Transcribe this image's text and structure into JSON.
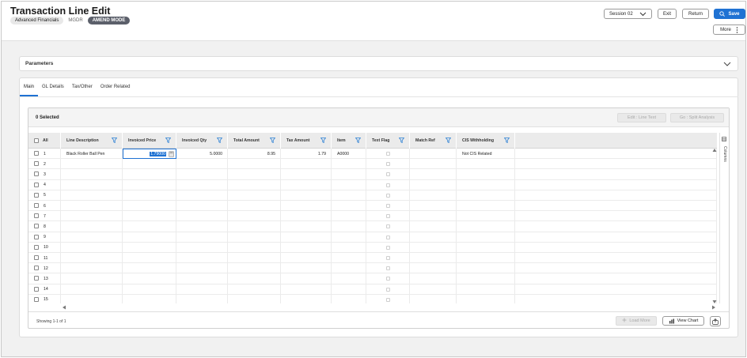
{
  "header": {
    "title": "Transaction Line Edit",
    "company": "Advanced Financials",
    "code": "MGDR",
    "mode": "AMEND MODE",
    "session_label": "Session 02",
    "exit_label": "Exit",
    "return_label": "Return",
    "save_label": "Save",
    "more_label": "More"
  },
  "parameters": {
    "title": "Parameters"
  },
  "tabs": [
    {
      "label": "Main",
      "active": true
    },
    {
      "label": "GL Details",
      "active": false
    },
    {
      "label": "Tax/Other",
      "active": false
    },
    {
      "label": "Order Related",
      "active": false
    }
  ],
  "grid": {
    "selected_count": "0 Selected",
    "edit_line_text": "Edit : Line Text",
    "go_split_analysis": "Go : Split Analysis",
    "all_label": "All",
    "columns_label": "Columns",
    "columns": [
      "Line Description",
      "Invoiced Price",
      "Invoiced Qty",
      "Total Amount",
      "Tax Amount",
      "Item",
      "Text Flag",
      "Match Ref",
      "CIS Withholding"
    ],
    "rows": [
      {
        "num": "1",
        "line_description": "Black Roller Ball Pen",
        "invoiced_price": "1.79000",
        "invoiced_qty": "5.0000",
        "total_amount": "8.95",
        "tax_amount": "1.79",
        "item": "A0000",
        "match_ref": "",
        "cis_withholding": "Not CIS Related"
      },
      {
        "num": "2"
      },
      {
        "num": "3"
      },
      {
        "num": "4"
      },
      {
        "num": "5"
      },
      {
        "num": "6"
      },
      {
        "num": "7"
      },
      {
        "num": "8"
      },
      {
        "num": "9"
      },
      {
        "num": "10"
      },
      {
        "num": "11"
      },
      {
        "num": "12"
      },
      {
        "num": "13"
      },
      {
        "num": "14"
      },
      {
        "num": "15"
      }
    ],
    "showing": "Showing 1-1 of 1",
    "load_more": "Load More",
    "view_chart": "View Chart"
  },
  "colors": {
    "accent": "#1f72d3",
    "mode_chip": "#5b5f6a",
    "filter_icon": "#2a7fd4"
  }
}
